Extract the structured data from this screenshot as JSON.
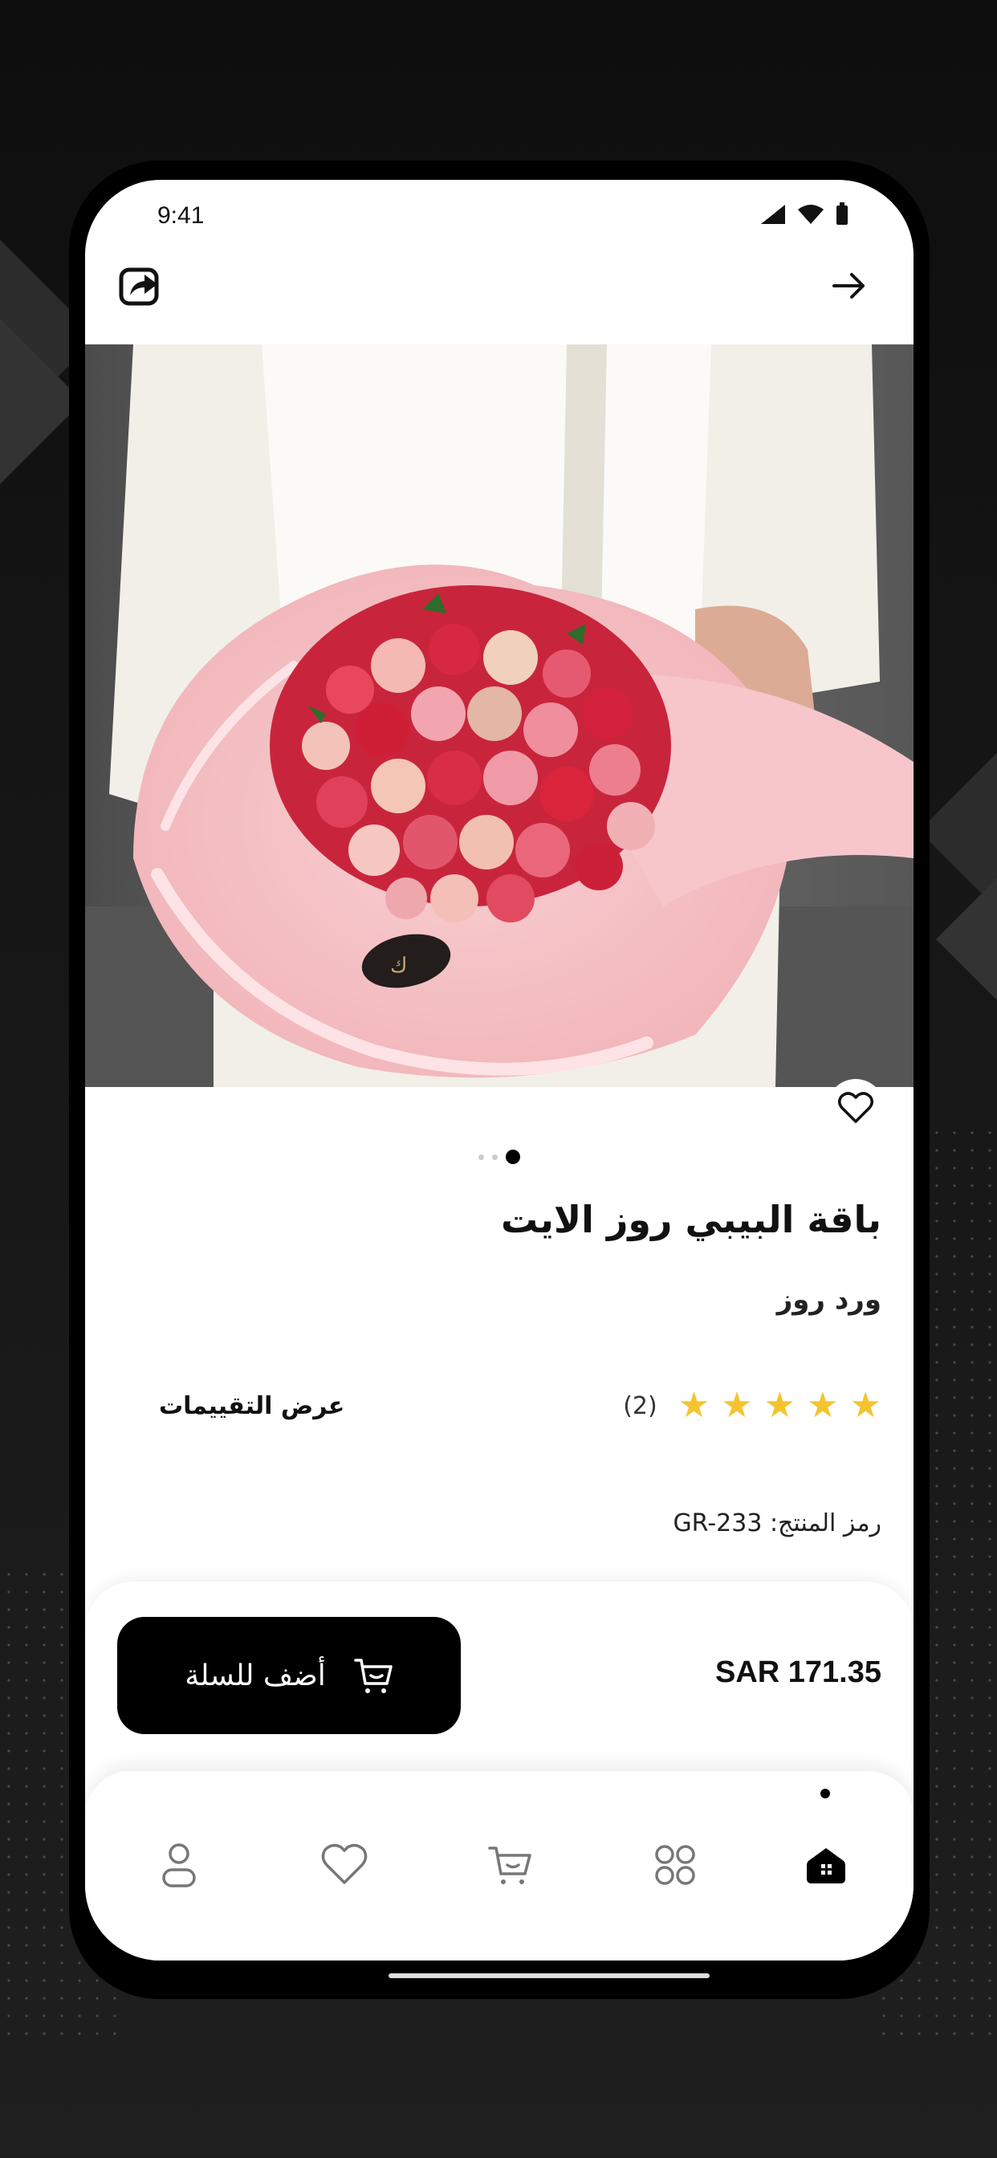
{
  "status_bar": {
    "time": "9:41"
  },
  "product": {
    "title": "باقة البيبي روز الايت",
    "category": "ورد روز",
    "rating": 5,
    "review_count": "(2)",
    "reviews_link": "عرض التقييمات",
    "sku_label": "رمز المنتج:",
    "sku": "GR-233",
    "price": "SAR 171.35"
  },
  "gallery": {
    "pages": 3,
    "active_index": 2
  },
  "actions": {
    "add_to_cart": "أضف للسلة"
  },
  "bottom_nav": {
    "items": [
      "home-icon",
      "categories-icon",
      "cart-icon",
      "favorites-icon",
      "profile-icon"
    ],
    "active": "home-icon"
  },
  "colors": {
    "primary": "#000000",
    "star": "#F4C430",
    "background": "#FFFFFF"
  }
}
